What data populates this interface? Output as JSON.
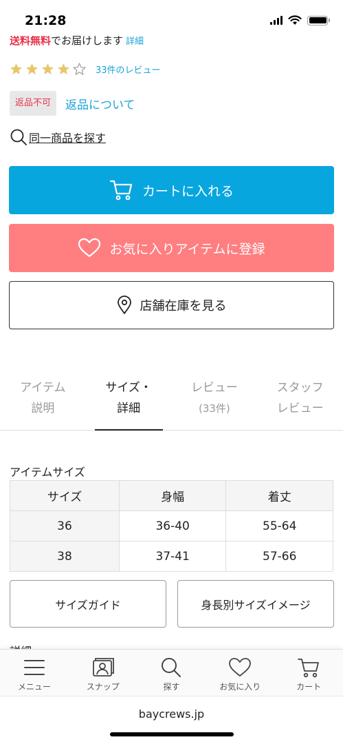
{
  "status": {
    "time": "21:28"
  },
  "shipping": {
    "free_label": "送料無料",
    "text": "でお届けします",
    "link": "詳細"
  },
  "rating": {
    "stars": 4,
    "max": 5,
    "review_link": "33件のレビュー"
  },
  "returns": {
    "badge": "返品不可",
    "link": "返品について"
  },
  "same_item": {
    "label": "同一商品を探す"
  },
  "actions": {
    "cart": "カートに入れる",
    "favorite": "お気に入りアイテムに登録",
    "store": "店舗在庫を見る"
  },
  "tabs": [
    {
      "line1": "アイテム",
      "line2": "説明",
      "active": false
    },
    {
      "line1": "サイズ・",
      "line2": "詳細",
      "active": true
    },
    {
      "line1": "レビュー",
      "line2": "(33件)",
      "active": false
    },
    {
      "line1": "スタッフ",
      "line2": "レビュー",
      "active": false
    }
  ],
  "size_section": {
    "title": "アイテムサイズ",
    "headers": [
      "サイズ",
      "身幅",
      "着丈"
    ],
    "rows": [
      [
        "36",
        "36-40",
        "55-64"
      ],
      [
        "38",
        "37-41",
        "57-66"
      ]
    ]
  },
  "guides": {
    "size_guide": "サイズガイド",
    "height_image": "身長別サイズイメージ"
  },
  "detail": {
    "title": "詳細"
  },
  "bottom_nav": [
    {
      "label": "メニュー",
      "icon": "menu-icon"
    },
    {
      "label": "スナップ",
      "icon": "snap-icon"
    },
    {
      "label": "探す",
      "icon": "search-icon"
    },
    {
      "label": "お気に入り",
      "icon": "heart-icon"
    },
    {
      "label": "カート",
      "icon": "cart-icon"
    }
  ],
  "browser": {
    "url": "baycrews.jp"
  },
  "colors": {
    "accent_blue": "#08a6df",
    "favorite_pink": "#ff7e80",
    "link_blue": "#1aa3d9",
    "alert_red": "#e8334a",
    "star_gold": "#e6c76a"
  }
}
